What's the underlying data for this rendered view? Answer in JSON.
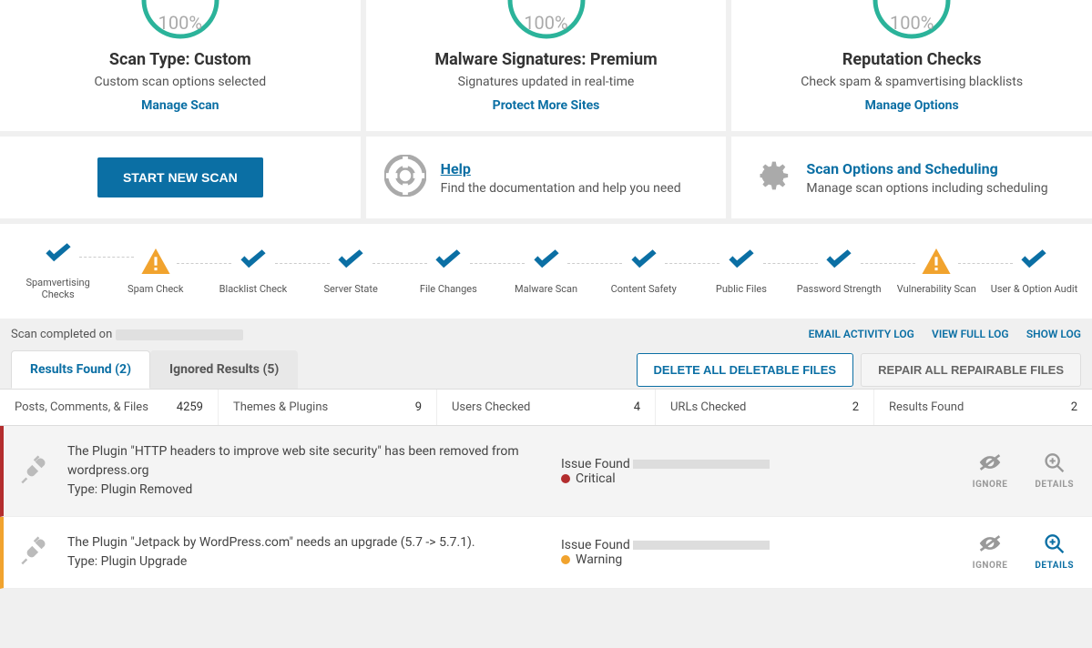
{
  "top_cards": [
    {
      "pct": "100%",
      "title": "Scan Type: Custom",
      "desc": "Custom scan options selected",
      "link": "Manage Scan"
    },
    {
      "pct": "100%",
      "title": "Malware Signatures: Premium",
      "desc": "Signatures updated in real-time",
      "link": "Protect More Sites"
    },
    {
      "pct": "100%",
      "title": "Reputation Checks",
      "desc": "Check spam & spamvertising blacklists",
      "link": "Manage Options"
    }
  ],
  "actions": {
    "start_scan": "START NEW SCAN",
    "help_title": "Help",
    "help_desc": "Find the documentation and help you need",
    "opts_title": "Scan Options and Scheduling",
    "opts_desc": "Manage scan options including scheduling"
  },
  "checks": [
    {
      "label": "Spamvertising Checks",
      "status": "ok"
    },
    {
      "label": "Spam Check",
      "status": "warn"
    },
    {
      "label": "Blacklist Check",
      "status": "ok"
    },
    {
      "label": "Server State",
      "status": "ok"
    },
    {
      "label": "File Changes",
      "status": "ok"
    },
    {
      "label": "Malware Scan",
      "status": "ok"
    },
    {
      "label": "Content Safety",
      "status": "ok"
    },
    {
      "label": "Public Files",
      "status": "ok"
    },
    {
      "label": "Password Strength",
      "status": "ok"
    },
    {
      "label": "Vulnerability Scan",
      "status": "warn"
    },
    {
      "label": "User & Option Audit",
      "status": "ok"
    }
  ],
  "status": {
    "completed_prefix": "Scan completed on ",
    "links": {
      "email": "EMAIL ACTIVITY LOG",
      "view": "VIEW FULL LOG",
      "show": "SHOW LOG"
    }
  },
  "tabs": {
    "results": "Results Found (2)",
    "ignored": "Ignored Results (5)",
    "delete": "DELETE ALL DELETABLE FILES",
    "repair": "REPAIR ALL REPAIRABLE FILES"
  },
  "stats": [
    {
      "label": "Posts, Comments, & Files",
      "val": "4259"
    },
    {
      "label": "Themes & Plugins",
      "val": "9"
    },
    {
      "label": "Users Checked",
      "val": "4"
    },
    {
      "label": "URLs Checked",
      "val": "2"
    },
    {
      "label": "Results Found",
      "val": "2"
    }
  ],
  "issues": [
    {
      "severity": "critical",
      "title": "The Plugin \"HTTP headers to improve web site security\" has been removed from wordpress.org",
      "type": "Type: Plugin Removed",
      "found_label": "Issue Found",
      "sev_label": "Critical",
      "ignore": "IGNORE",
      "details": "DETAILS",
      "details_active": false
    },
    {
      "severity": "warning",
      "title": "The Plugin \"Jetpack by WordPress.com\" needs an upgrade (5.7 -> 5.7.1).",
      "type": "Type: Plugin Upgrade",
      "found_label": "Issue Found",
      "sev_label": "Warning",
      "ignore": "IGNORE",
      "details": "DETAILS",
      "details_active": true
    }
  ]
}
